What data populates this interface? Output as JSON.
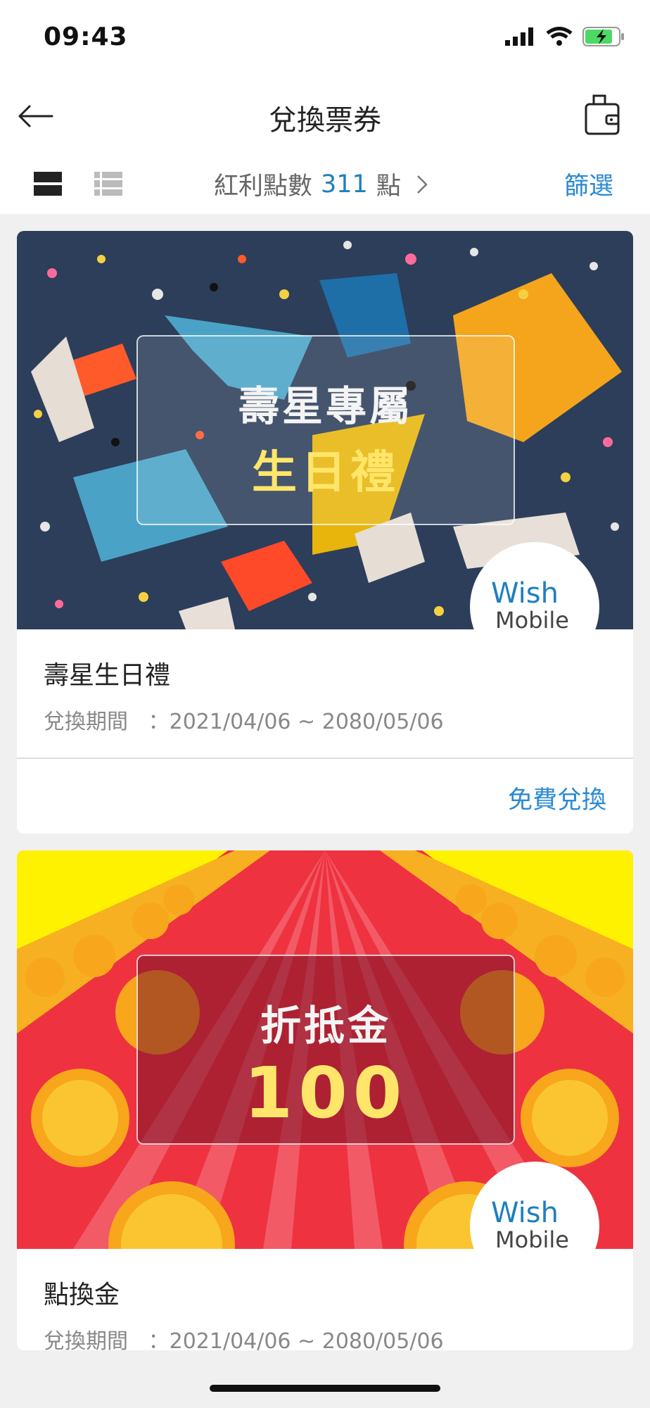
{
  "status": {
    "time": "09:43"
  },
  "header": {
    "title": "兌換票券"
  },
  "toolbar": {
    "points_label": "紅利點數",
    "points_value": "311",
    "points_unit": "點",
    "filter": "篩選"
  },
  "coupons": [
    {
      "banner_line1": "壽星專屬",
      "banner_line2": "生日禮",
      "logo_top": "Wish",
      "logo_bottom": "Mobile",
      "title": "壽星生日禮",
      "period_label": "兌換期間",
      "period_value": "：2021/04/06 ~ 2080/05/06",
      "action": "免費兌換"
    },
    {
      "banner_line1": "折抵金",
      "banner_line2": "100",
      "logo_top": "Wish",
      "logo_bottom": "Mobile",
      "title": "點換金",
      "period_label": "兌換期間",
      "period_value": "：2021/04/06 ~ 2080/05/06"
    }
  ],
  "colors": {
    "accent": "#2a8ad4",
    "points": "#1e7fc0"
  }
}
